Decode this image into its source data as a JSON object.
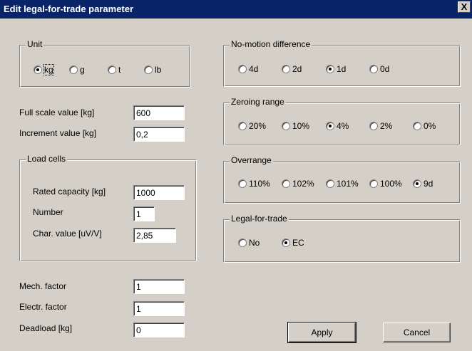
{
  "window": {
    "title": "Edit legal-for-trade parameter",
    "close_glyph": "X"
  },
  "unit": {
    "label": "Unit",
    "options": [
      "kg",
      "g",
      "t",
      "lb"
    ],
    "selected": "kg"
  },
  "no_motion": {
    "label": "No-motion difference",
    "options": [
      "4d",
      "2d",
      "1d",
      "0d"
    ],
    "selected": "1d"
  },
  "zeroing": {
    "label": "Zeroing range",
    "options": [
      "20%",
      "10%",
      "4%",
      "2%",
      "0%"
    ],
    "selected": "4%"
  },
  "overrange": {
    "label": "Overrange",
    "options": [
      "110%",
      "102%",
      "101%",
      "100%",
      "9d"
    ],
    "selected": "9d"
  },
  "legal": {
    "label": "Legal-for-trade",
    "options": [
      "No",
      "EC"
    ],
    "selected": "EC"
  },
  "fields": {
    "full_scale": {
      "label": "Full scale value [kg]",
      "value": "600"
    },
    "increment": {
      "label": "Increment value [kg]",
      "value": "0,2"
    },
    "mech_factor": {
      "label": "Mech. factor",
      "value": "1"
    },
    "electr_factor": {
      "label": "Electr. factor",
      "value": "1"
    },
    "deadload": {
      "label": "Deadload [kg]",
      "value": "0"
    }
  },
  "load_cells": {
    "label": "Load cells",
    "rated": {
      "label": "Rated capacity [kg]",
      "value": "1000"
    },
    "number": {
      "label": "Number",
      "value": "1"
    },
    "char": {
      "label": "Char. value [uV/V]",
      "value": "2,85"
    }
  },
  "buttons": {
    "apply": "Apply",
    "cancel": "Cancel"
  }
}
